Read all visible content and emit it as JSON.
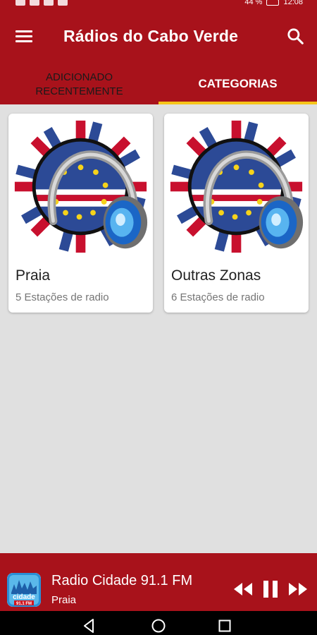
{
  "status_bar": {
    "battery": "44 %",
    "time": "12:08"
  },
  "app_bar": {
    "title": "Rádios do Cabo Verde",
    "menu_icon": "menu-icon",
    "search_icon": "search-icon"
  },
  "tabs": [
    {
      "label": "ADICIONADO\nRECENTEMENTE",
      "selected": false
    },
    {
      "label": "CATEGORIAS",
      "selected": true
    }
  ],
  "categories": [
    {
      "title": "Praia",
      "subtitle": "5 Estações de radio"
    },
    {
      "title": "Outras Zonas",
      "subtitle": "6 Estações de radio"
    }
  ],
  "player": {
    "station_name": "Radio Cidade 91.1 FM",
    "station_location": "Praia",
    "logo_text": "cidade",
    "logo_freq": "91.1 FM",
    "controls": [
      "previous-icon",
      "pause-icon",
      "next-icon"
    ]
  },
  "colors": {
    "primary": "#a8121b",
    "tab_indicator": "#f6c419",
    "background": "#e0e0e0"
  }
}
